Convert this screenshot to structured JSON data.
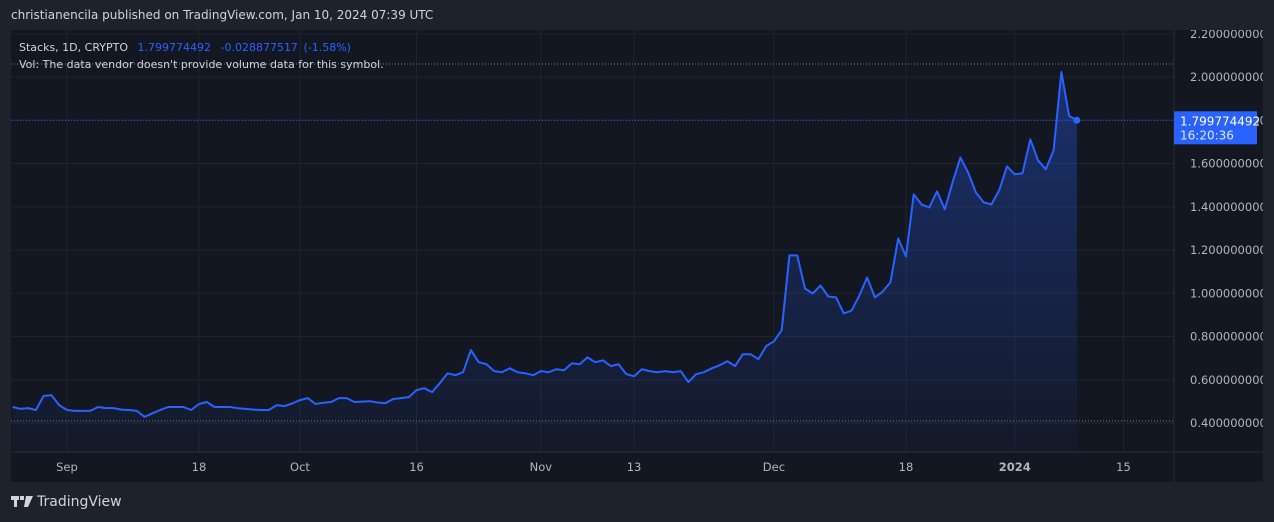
{
  "header": {
    "published": "christianencila published on TradingView.com, Jan 10, 2024 07:39 UTC"
  },
  "legend": {
    "symbol": "Stacks, 1D, CRYPTO",
    "price": "1.799774492",
    "change": "-0.028877517",
    "change_pct": "(-1.58%)",
    "volume_note": "Vol: The data vendor doesn't provide volume data for this symbol."
  },
  "price_label": {
    "value": "1.799774492",
    "countdown": "16:20:36"
  },
  "footer": {
    "brand": "TradingView"
  },
  "colors": {
    "line": "#2962ff",
    "bg": "#131722",
    "outer": "#1e222d"
  },
  "chart_data": {
    "type": "area",
    "title": "Stacks, 1D, CRYPTO",
    "x_unit": "days since Sep 1, 2023",
    "y_ticks": [
      "0.400000000",
      "0.600000000",
      "0.800000000",
      "1.000000000",
      "1.200000000",
      "1.400000000",
      "1.600000000",
      "1.800000000",
      "2.000000000",
      "2.200000000"
    ],
    "y_tick_values": [
      0.4,
      0.6,
      0.8,
      1.0,
      1.2,
      1.4,
      1.6,
      1.8,
      2.0,
      2.2
    ],
    "ylim": [
      0.32,
      2.28
    ],
    "x_ticks": [
      {
        "label": "Sep",
        "day": 0
      },
      {
        "label": "18",
        "day": 17
      },
      {
        "label": "Oct",
        "day": 30
      },
      {
        "label": "16",
        "day": 45
      },
      {
        "label": "Nov",
        "day": 61
      },
      {
        "label": "13",
        "day": 73
      },
      {
        "label": "Dec",
        "day": 91
      },
      {
        "label": "18",
        "day": 108
      },
      {
        "label": "2024",
        "day": 122
      },
      {
        "label": "15",
        "day": 136
      }
    ],
    "xlim": [
      -7.2,
      142.5
    ],
    "series": [
      {
        "name": "Stacks",
        "points": [
          [
            -7,
            0.474
          ],
          [
            -6,
            0.465
          ],
          [
            -5,
            0.469
          ],
          [
            -4,
            0.46
          ],
          [
            -3,
            0.525
          ],
          [
            -2,
            0.529
          ],
          [
            -1,
            0.483
          ],
          [
            0,
            0.46
          ],
          [
            1,
            0.456
          ],
          [
            2,
            0.456
          ],
          [
            3,
            0.456
          ],
          [
            4,
            0.474
          ],
          [
            5,
            0.469
          ],
          [
            6,
            0.469
          ],
          [
            7,
            0.462
          ],
          [
            8,
            0.46
          ],
          [
            9,
            0.456
          ],
          [
            10,
            0.428
          ],
          [
            11,
            0.445
          ],
          [
            12,
            0.46
          ],
          [
            13,
            0.474
          ],
          [
            14,
            0.474
          ],
          [
            15,
            0.474
          ],
          [
            16,
            0.46
          ],
          [
            17,
            0.488
          ],
          [
            18,
            0.497
          ],
          [
            19,
            0.474
          ],
          [
            20,
            0.474
          ],
          [
            21,
            0.474
          ],
          [
            22,
            0.468
          ],
          [
            23,
            0.465
          ],
          [
            24,
            0.462
          ],
          [
            25,
            0.46
          ],
          [
            26,
            0.46
          ],
          [
            27,
            0.483
          ],
          [
            28,
            0.478
          ],
          [
            29,
            0.49
          ],
          [
            30,
            0.506
          ],
          [
            31,
            0.515
          ],
          [
            32,
            0.488
          ],
          [
            33,
            0.494
          ],
          [
            34,
            0.497
          ],
          [
            35,
            0.515
          ],
          [
            36,
            0.515
          ],
          [
            37,
            0.497
          ],
          [
            38,
            0.499
          ],
          [
            39,
            0.501
          ],
          [
            40,
            0.495
          ],
          [
            41,
            0.492
          ],
          [
            42,
            0.511
          ],
          [
            43,
            0.515
          ],
          [
            44,
            0.52
          ],
          [
            45,
            0.552
          ],
          [
            46,
            0.561
          ],
          [
            47,
            0.543
          ],
          [
            48,
            0.584
          ],
          [
            49,
            0.63
          ],
          [
            50,
            0.621
          ],
          [
            51,
            0.635
          ],
          [
            52,
            0.737
          ],
          [
            53,
            0.681
          ],
          [
            54,
            0.672
          ],
          [
            55,
            0.64
          ],
          [
            56,
            0.635
          ],
          [
            57,
            0.653
          ],
          [
            58,
            0.635
          ],
          [
            59,
            0.63
          ],
          [
            60,
            0.621
          ],
          [
            61,
            0.64
          ],
          [
            62,
            0.635
          ],
          [
            63,
            0.649
          ],
          [
            64,
            0.644
          ],
          [
            65,
            0.676
          ],
          [
            66,
            0.672
          ],
          [
            67,
            0.704
          ],
          [
            68,
            0.681
          ],
          [
            69,
            0.69
          ],
          [
            70,
            0.663
          ],
          [
            71,
            0.672
          ],
          [
            72,
            0.626
          ],
          [
            73,
            0.616
          ],
          [
            74,
            0.649
          ],
          [
            75,
            0.64
          ],
          [
            76,
            0.635
          ],
          [
            77,
            0.64
          ],
          [
            78,
            0.635
          ],
          [
            79,
            0.64
          ],
          [
            80,
            0.589
          ],
          [
            81,
            0.626
          ],
          [
            82,
            0.635
          ],
          [
            83,
            0.653
          ],
          [
            84,
            0.667
          ],
          [
            85,
            0.686
          ],
          [
            86,
            0.663
          ],
          [
            87,
            0.718
          ],
          [
            88,
            0.718
          ],
          [
            89,
            0.695
          ],
          [
            90,
            0.755
          ],
          [
            91,
            0.778
          ],
          [
            92,
            0.829
          ],
          [
            93,
            1.175
          ],
          [
            94,
            1.175
          ],
          [
            95,
            1.022
          ],
          [
            96,
            0.999
          ],
          [
            97,
            1.036
          ],
          [
            98,
            0.985
          ],
          [
            99,
            0.981
          ],
          [
            100,
            0.907
          ],
          [
            101,
            0.92
          ],
          [
            102,
            0.99
          ],
          [
            103,
            1.073
          ],
          [
            104,
            0.981
          ],
          [
            105,
            1.008
          ],
          [
            106,
            1.05
          ],
          [
            107,
            1.253
          ],
          [
            108,
            1.17
          ],
          [
            109,
            1.457
          ],
          [
            110,
            1.411
          ],
          [
            111,
            1.397
          ],
          [
            112,
            1.471
          ],
          [
            113,
            1.388
          ],
          [
            114,
            1.513
          ],
          [
            115,
            1.628
          ],
          [
            116,
            1.559
          ],
          [
            117,
            1.466
          ],
          [
            118,
            1.42
          ],
          [
            119,
            1.411
          ],
          [
            120,
            1.476
          ],
          [
            121,
            1.587
          ],
          [
            122,
            1.55
          ],
          [
            123,
            1.555
          ],
          [
            124,
            1.712
          ],
          [
            125,
            1.615
          ],
          [
            126,
            1.573
          ],
          [
            127,
            1.661
          ],
          [
            128,
            2.023
          ],
          [
            129,
            1.82
          ],
          [
            130,
            1.7998
          ]
        ]
      }
    ],
    "high_line": 2.06,
    "low_line": 0.41,
    "last_value": 1.799774492,
    "grid": true
  }
}
